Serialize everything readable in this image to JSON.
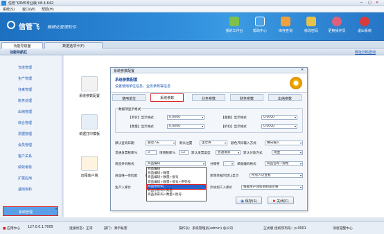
{
  "window": {
    "title": "信管飞RMS专业版 V8.4.642"
  },
  "menu": [
    "系统(S)",
    "窗口(W)",
    "帮助(H)"
  ],
  "banner": {
    "logo": "信管飞",
    "slogan": "精细化管理软件",
    "buttons": [
      {
        "label": "我的工作台",
        "icon": "workbench-icon",
        "color": "#7fc04b"
      },
      {
        "label": "帮助中心",
        "icon": "help-icon",
        "color": "#4aa3e8"
      },
      {
        "label": "库存查询",
        "icon": "inventory-icon",
        "color": "#f0a03c"
      },
      {
        "label": "修改密码",
        "icon": "password-icon",
        "color": "#e8c24a"
      },
      {
        "label": "更换操作员",
        "icon": "user-switch-icon",
        "color": "#e0607a"
      },
      {
        "label": "退出系统",
        "icon": "exit-icon",
        "color": "#d93b3b"
      }
    ]
  },
  "tabs": [
    {
      "label": "功能导航面"
    },
    {
      "label": "数据选项卡(F)"
    }
  ],
  "navhead": {
    "title": "功能导航栏",
    "link": "网址扫码查询"
  },
  "sidebar": [
    "仓库管理",
    "生产管理",
    "往来管理",
    "账务处理",
    "出纳管理",
    "综合管理",
    "票据管理",
    "会员管理",
    "客户关系",
    "绩效考核",
    "扩展应用",
    "基础资料",
    "系统管理"
  ],
  "modules": [
    "系统参数配置",
    "单据打印模板",
    "远程客户端"
  ],
  "dialog": {
    "title": "系统参数配置",
    "head_title": "系统参数配置",
    "head_sub": "设置使用单位信息，业务参数等信息",
    "tabs": [
      "使用单位",
      "系统参数",
      "业务参数",
      "财务参数",
      "出纳参数"
    ],
    "group_title": "数据项显示格式",
    "fmt": {
      "unit_price_lbl": "【单价】显示格式",
      "unit_price_val": "0.0000",
      "amount_lbl": "【金额】显示格式",
      "amount_val": "0.0000",
      "qty_lbl": "【数量】显示格式",
      "qty_val": "0.0000",
      "discount_lbl": "【折扣】显示格式",
      "discount_val": "0.0000"
    },
    "r1": {
      "query_date_lbl": "默认查询日期",
      "query_date_val": "最近7天",
      "location_lbl": "默认位置",
      "location_val": "主仓库",
      "color_lbl": "颜色尺码输入方式",
      "color_val": "横向输入"
    },
    "r2": {
      "tax_lbl": "普通发票税率%",
      "tax_val": "3",
      "addtax_lbl": "增值税率%",
      "addtax_val": "13",
      "invoice_type_lbl": "默认发票类型",
      "invoice_type_val": "普通发票",
      "payment_lbl": "默认付款方式",
      "payment_val": "现金"
    },
    "r3": {
      "barcode_lbl": "商品条码格式",
      "barcode_val": "商品编码",
      "sep_lbl": "分隔符",
      "sep_val": "-",
      "barcode_name_lbl": "单据编码格式",
      "barcode_name_val": "商品名称+规格"
    },
    "r4": {
      "unique_lbl": "商品唯一性匹配",
      "unique_check": "",
      "newdoc_lbl": "新增单据时默认显示",
      "newdoc_val": "所有人可查看"
    },
    "r5": {
      "produce_lbl": "生产入库价",
      "outsource_lbl": "外协加工入库价",
      "outsource_val": "根据生产领料到制单价格"
    },
    "dropdown": [
      "商品编码",
      "商品编码+数量",
      "商品编码+数量+批号",
      "商品编码+数量+批号+序列号",
      "商品条形码",
      "商品条形码+数量",
      "商品条形码+数量+批号"
    ],
    "dropdown_selected": 4,
    "save": "保存(S)",
    "close": "关闭(C)"
  },
  "status": {
    "app": "应用中心",
    "server": "127.0.0.1:7005",
    "conn": "连接状态：正常",
    "dept": "部门：演示账套",
    "operator": "操作员：系统管理员(admin) 总公司",
    "version": "正式版 授权序列号：p-0001",
    "msg": "消息提醒中心"
  },
  "colors": {
    "accent": "#2a62c9",
    "red_highlight": "#d22"
  }
}
